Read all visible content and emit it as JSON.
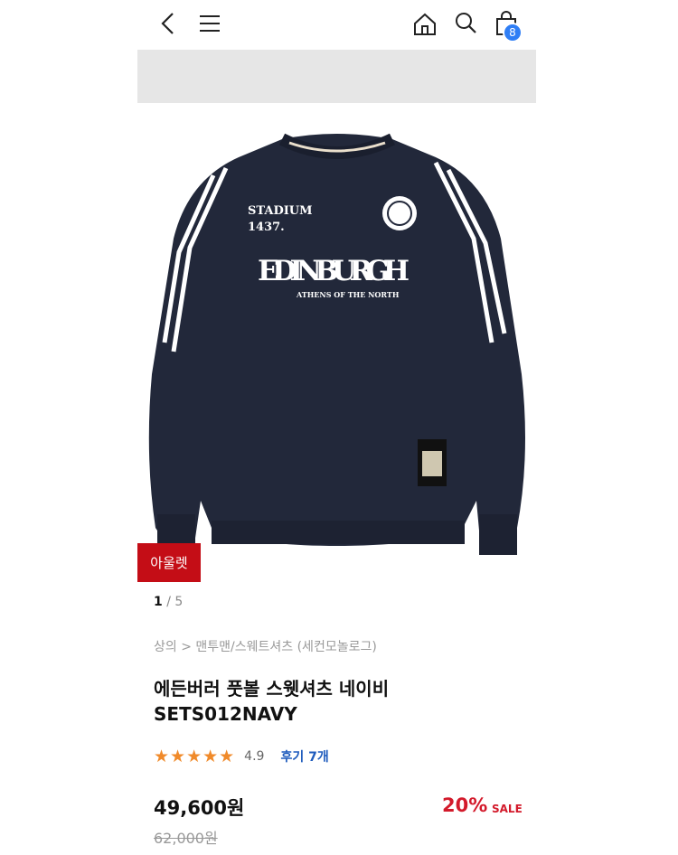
{
  "header": {
    "back_icon": "chevron-left-icon",
    "menu_icon": "hamburger-icon",
    "home_icon": "home-icon",
    "search_icon": "search-icon",
    "cart_icon": "shopping-bag-icon",
    "cart_count": "8"
  },
  "product_image": {
    "print_lines": [
      "STADIUM",
      "1437.",
      "EDINBURGH",
      "ATHENS OF THE NORTH"
    ],
    "badge": "아울렛"
  },
  "pager": {
    "current": "1",
    "separator": "/",
    "total": "5"
  },
  "breadcrumb": "상의 > 맨투맨/스웨트셔츠 (세컨모놀로그)",
  "product": {
    "name": "에든버러 풋볼 스웻셔츠 네이비",
    "code": "SETS012NAVY"
  },
  "rating": {
    "stars": 5,
    "value": "4.9",
    "reviews_label": "후기 7개"
  },
  "price": {
    "current": "49,600원",
    "discount": "20%",
    "sale_label": "SALE",
    "original": "62,000원"
  },
  "colors": {
    "accent_red": "#c40d16",
    "badge_blue": "#2f7ef5",
    "star": "#f08a2a",
    "link_blue": "#1e5bbd"
  }
}
